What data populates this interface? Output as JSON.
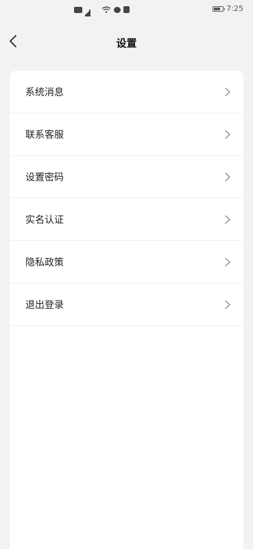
{
  "status_bar": {
    "time": "7:25"
  },
  "header": {
    "title": "设置",
    "back_icon": "chevron-left-icon"
  },
  "settings": {
    "items": [
      {
        "label": "系统消息"
      },
      {
        "label": "联系客服"
      },
      {
        "label": "设置密码"
      },
      {
        "label": "实名认证"
      },
      {
        "label": "隐私政策"
      },
      {
        "label": "退出登录"
      }
    ],
    "item_icon": "chevron-right-icon"
  }
}
